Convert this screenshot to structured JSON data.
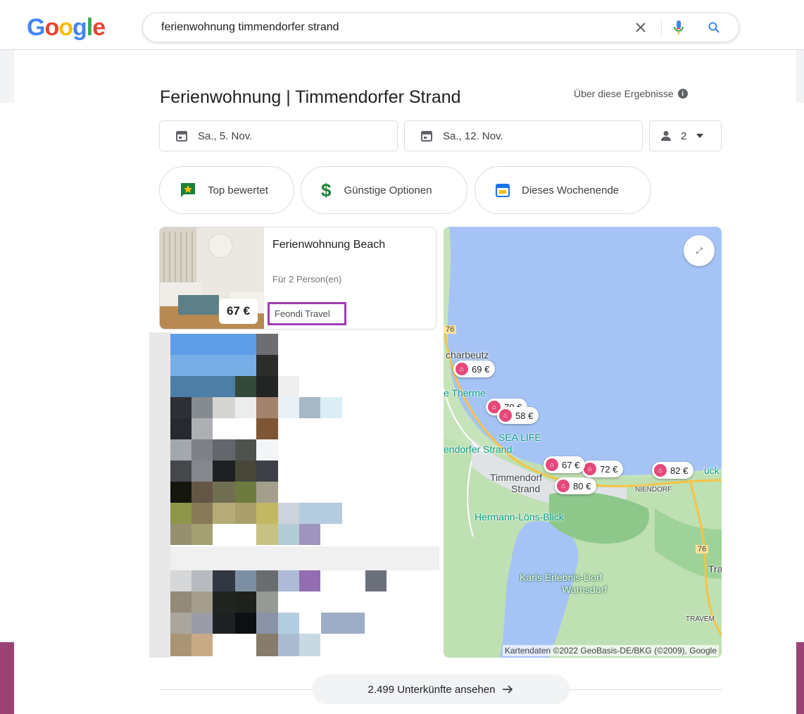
{
  "header": {
    "logo_letters": [
      "G",
      "o",
      "o",
      "g",
      "l",
      "e"
    ],
    "search_query": "ferienwohnung timmendorfer strand"
  },
  "result": {
    "title": "Ferienwohnung | Timmendorfer Strand",
    "about": "Über diese Ergebnisse",
    "checkin": "Sa., 5. Nov.",
    "checkout": "Sa., 12. Nov.",
    "guests": "2",
    "chips": [
      "Top bewertet",
      "Günstige Optionen",
      "Dieses Wochenende"
    ]
  },
  "card": {
    "name": "Ferienwohnung Beach",
    "guests": "Für 2 Person(en)",
    "provider": "Feondi Travel",
    "price": "67 €"
  },
  "map": {
    "pins": [
      "69 €",
      "70 €",
      "58 €",
      "67 €",
      "72 €",
      "80 €",
      "82 €"
    ],
    "labels": {
      "scharbeutz": "charbeutz",
      "therme": "e Therme",
      "sealife": "SEA LIFE",
      "timmendorfer_strand_top": "endorfer Strand",
      "timmendorf1": "Timmendorf",
      "timmendorf2": "Strand",
      "niendorf": "NIENDORF",
      "hermann": "Hermann-Löns-Blick",
      "karls1": "Karls Erlebnis-Dorf",
      "karls2": "Warnsdorf",
      "travem": "TRAVEM",
      "tra": "Tra",
      "luck": "ück",
      "road76a": "76",
      "road76b": "76"
    },
    "attribution": "Kartendaten ©2022 GeoBasis-DE/BKG (©2009), Google"
  },
  "footer": {
    "more_button": "2.499 Unterkünfte ansehen"
  },
  "colors": {
    "accent": "#1a73e8",
    "pin": "#e5497a",
    "water": "#a5c4f5",
    "provider_highlight": "#9c3fb0",
    "side_band": "#9a4273"
  }
}
